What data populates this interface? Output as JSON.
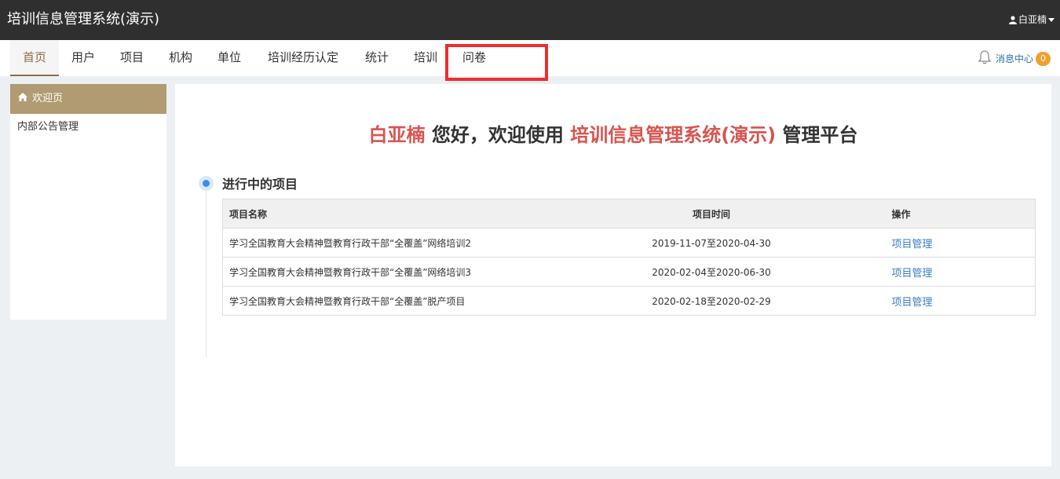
{
  "app": {
    "title": "培训信息管理系统(演示)"
  },
  "user": {
    "name": "白亚楠",
    "icon": "user-icon"
  },
  "nav": {
    "items": [
      {
        "label": "首页"
      },
      {
        "label": "用户"
      },
      {
        "label": "项目"
      },
      {
        "label": "机构"
      },
      {
        "label": "单位"
      },
      {
        "label": "培训经历认定"
      },
      {
        "label": "统计"
      },
      {
        "label": "培训"
      },
      {
        "label": "问卷"
      }
    ],
    "active": "首页",
    "highlighted": "问卷"
  },
  "messages": {
    "label": "消息中心",
    "count": "0",
    "icon": "bell-icon"
  },
  "sidebar": {
    "header": {
      "label": "欢迎页",
      "icon": "home-icon"
    },
    "items": [
      {
        "label": "内部公告管理"
      }
    ]
  },
  "welcome": {
    "user": "白亚楠",
    "greeting": " 您好，欢迎使用 ",
    "system": "培训信息管理系统(演示)",
    "suffix": " 管理平台"
  },
  "projects": {
    "title": "进行中的项目",
    "columns": [
      "项目名称",
      "项目时间",
      "操作"
    ],
    "rows": [
      {
        "name": "学习全国教育大会精神暨教育行政干部“全覆盖”网络培训2",
        "time": "2019-11-07至2020-04-30",
        "action": "项目管理"
      },
      {
        "name": "学习全国教育大会精神暨教育行政干部“全覆盖”网络培训3",
        "time": "2020-02-04至2020-06-30",
        "action": "项目管理"
      },
      {
        "name": "学习全国教育大会精神暨教育行政干部“全覆盖”脱产项目",
        "time": "2020-02-18至2020-02-29",
        "action": "项目管理"
      }
    ]
  },
  "colors": {
    "topbar": "#2f2f2f",
    "accent": "#b09b72",
    "highlight": "#d9534f",
    "link": "#3d7ec4",
    "badge": "#f0a030",
    "annotation_box": "#f02d2d"
  }
}
